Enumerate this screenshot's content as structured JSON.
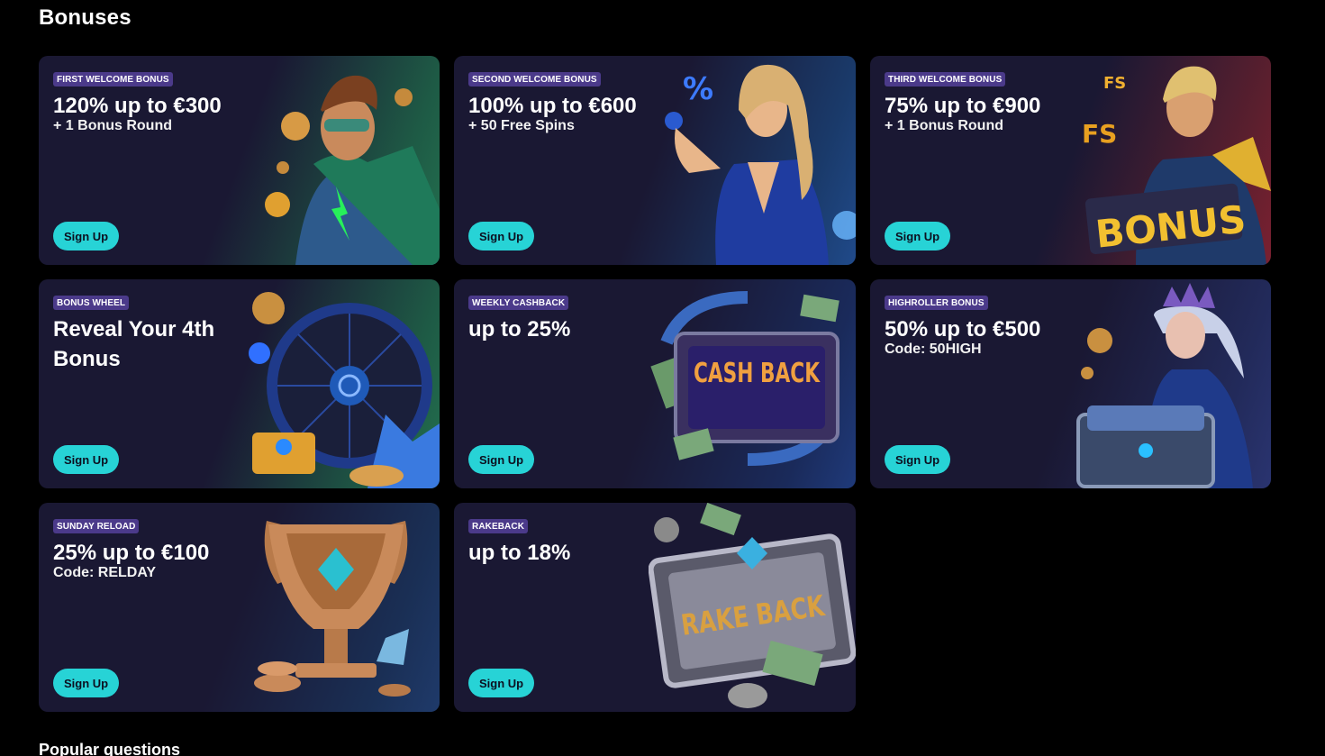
{
  "page": {
    "title": "Bonuses"
  },
  "cards": [
    {
      "badge": "FIRST WELCOME BONUS",
      "headline": "120% up to €300",
      "sub": "+ 1 Bonus Round",
      "cta": "Sign Up",
      "art": "superhero-man"
    },
    {
      "badge": "SECOND WELCOME BONUS",
      "headline": "100% up to €600",
      "sub": "+ 50 Free Spins",
      "cta": "Sign Up",
      "art": "woman-blue-suit"
    },
    {
      "badge": "THIRD WELCOME BONUS",
      "headline": "75% up to €900",
      "sub": "+ 1 Bonus Round",
      "cta": "Sign Up",
      "art": "hero-bonus-sign",
      "art_text": "BONUS"
    },
    {
      "badge": "BONUS WHEEL",
      "headline": "Reveal Your 4th Bonus",
      "sub": "",
      "cta": "Sign Up",
      "art": "bonus-wheel"
    },
    {
      "badge": "WEEKLY CASHBACK",
      "headline": "up to 25%",
      "sub": "",
      "cta": "Sign Up",
      "art": "cashback-box",
      "art_text": "CASH BACK"
    },
    {
      "badge": "HIGHROLLER BONUS",
      "headline": "50% up to €500",
      "sub": "Code: 50HIGH",
      "cta": "Sign Up",
      "art": "queen-treasure-chest"
    },
    {
      "badge": "SUNDAY RELOAD",
      "headline": "25% up to €100",
      "sub": "Code: RELDAY",
      "cta": "Sign Up",
      "art": "trophy-cup"
    },
    {
      "badge": "RAKEBACK",
      "headline": "up to 18%",
      "sub": "",
      "cta": "Sign Up",
      "art": "rakeback-plaque",
      "art_text": "RAKE BACK"
    }
  ],
  "footer": {
    "heading": "Popular questions"
  },
  "colors": {
    "card_bg": "#1a1833",
    "badge_bg": "#4b3a8a",
    "cta_bg": "#27d3d6",
    "page_bg": "#000000"
  }
}
